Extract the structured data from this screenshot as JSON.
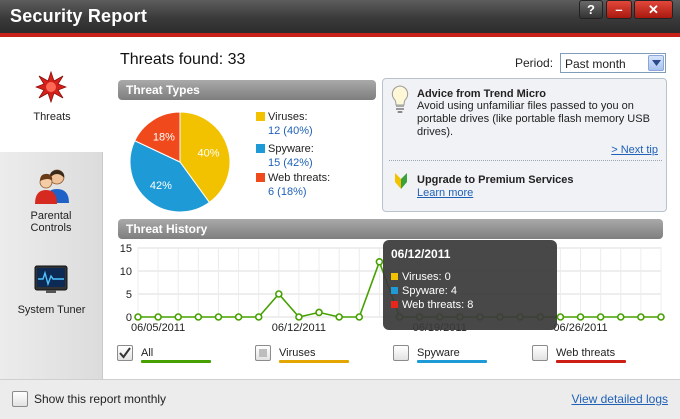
{
  "window": {
    "title": "Security Report",
    "help_label": "?",
    "minimize_label": "–",
    "close_label": "✕"
  },
  "sidebar": {
    "items": [
      {
        "label": "Threats",
        "icon": "threats-burst-icon",
        "selected": true
      },
      {
        "label": "Parental Controls",
        "icon": "parental-users-icon",
        "selected": false
      },
      {
        "label": "System Tuner",
        "icon": "system-tuner-monitor-icon",
        "selected": false
      }
    ]
  },
  "summary": {
    "threats_found": "Threats found: 33"
  },
  "period": {
    "label": "Period:",
    "selected": "Past month"
  },
  "threat_types": {
    "header": "Threat Types",
    "items": [
      {
        "name": "Viruses:",
        "count": "12 (40%)",
        "pie_label": "40%",
        "value": 40,
        "color": "#f2c200"
      },
      {
        "name": "Spyware:",
        "count": "15 (42%)",
        "pie_label": "42%",
        "value": 42,
        "color": "#1e9bd7"
      },
      {
        "name": "Web threats:",
        "count": "6 (18%)",
        "pie_label": "18%",
        "value": 18,
        "color": "#f04a1c"
      }
    ]
  },
  "advice": {
    "title": "Advice from Trend Micro",
    "text": "Avoid using unfamiliar files passed to you on portable drives (like portable flash memory USB drives).",
    "next_tip": "> Next tip",
    "upgrade_title": "Upgrade to Premium Services",
    "learn_more": "Learn more"
  },
  "history": {
    "header": "Threat History",
    "tooltip": {
      "date": "06/12/2011",
      "rows": [
        {
          "text": "Viruses: 0",
          "color": "#f2c200"
        },
        {
          "text": "Spyware: 4",
          "color": "#1e9bd7"
        },
        {
          "text": "Web threats: 8",
          "color": "#e8261b"
        }
      ]
    },
    "filters": [
      {
        "label": "All",
        "checked": true,
        "color": "#46a100"
      },
      {
        "label": "Viruses",
        "checked": false,
        "color": "#e3a500"
      },
      {
        "label": "Spyware",
        "checked": false,
        "color": "#1e9bd7"
      },
      {
        "label": "Web threats",
        "checked": false,
        "color": "#cc1e14"
      }
    ]
  },
  "chart_data": {
    "type": "line",
    "ylim": [
      0,
      15
    ],
    "yticks": [
      0,
      5,
      10,
      15
    ],
    "xtick_labels": [
      "06/05/2011",
      "06/12/2011",
      "06/19/2011",
      "06/26/2011"
    ],
    "xtick_indices": [
      1,
      8,
      15,
      22
    ],
    "grid": true,
    "series": [
      {
        "color": "#46a100",
        "values": [
          0,
          0,
          0,
          0,
          0,
          0,
          0,
          5,
          0,
          1,
          0,
          0,
          12,
          0,
          0,
          0,
          0,
          0,
          0,
          0,
          0,
          0,
          0,
          0,
          0,
          0,
          0
        ]
      }
    ]
  },
  "footer": {
    "monthly_label": "Show this report monthly",
    "view_logs": "View detailed logs"
  }
}
